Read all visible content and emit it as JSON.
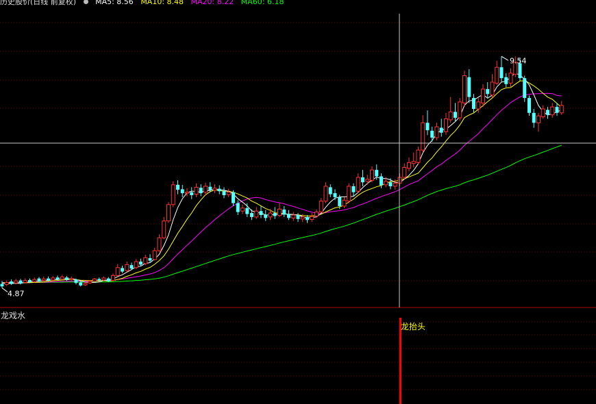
{
  "header": {
    "title": "历史股价(日线 前复权)",
    "ma_labels": [
      {
        "text": "MA5: 8.56",
        "color": "#ffffff"
      },
      {
        "text": "MA10: 8.48",
        "color": "#ffff00"
      },
      {
        "text": "MA20: 8.22",
        "color": "#ff00ff"
      },
      {
        "text": "MA60: 6.18",
        "color": "#00ff00"
      }
    ]
  },
  "indicator": {
    "name": "龙戏水",
    "signal_label": "龙抬头",
    "signal_color": "#ff0000"
  },
  "chart_data": {
    "type": "candlestick",
    "high_label": "9.54",
    "low_label": "4.87",
    "y_range": [
      4.6,
      10.4
    ],
    "candles": [
      [
        4.95,
        4.9,
        5.01,
        4.87
      ],
      [
        4.94,
        4.98,
        5.02,
        4.91
      ],
      [
        5.0,
        4.95,
        5.04,
        4.93
      ],
      [
        4.97,
        5.01,
        5.05,
        4.94
      ],
      [
        5.02,
        4.96,
        5.05,
        4.94
      ],
      [
        4.98,
        5.02,
        5.06,
        4.96
      ],
      [
        5.03,
        4.99,
        5.06,
        4.97
      ],
      [
        5.0,
        5.04,
        5.08,
        4.98
      ],
      [
        5.06,
        5.0,
        5.09,
        4.98
      ],
      [
        5.02,
        5.05,
        5.1,
        5.0
      ],
      [
        5.06,
        5.02,
        5.1,
        5.0
      ],
      [
        5.03,
        5.07,
        5.11,
        5.01
      ],
      [
        5.08,
        5.04,
        5.12,
        5.02
      ],
      [
        5.05,
        5.09,
        5.13,
        5.03
      ],
      [
        5.08,
        5.03,
        5.11,
        5.01
      ],
      [
        5.04,
        5.06,
        5.1,
        5.02
      ],
      [
        5.04,
        4.97,
        5.06,
        4.94
      ],
      [
        4.98,
        4.92,
        5.0,
        4.9
      ],
      [
        4.93,
        4.96,
        4.99,
        4.91
      ],
      [
        4.97,
        5.0,
        5.03,
        4.95
      ],
      [
        5.01,
        5.05,
        5.07,
        4.99
      ],
      [
        5.05,
        5.02,
        5.08,
        5.0
      ],
      [
        5.03,
        5.07,
        5.1,
        5.01
      ],
      [
        5.06,
        5.0,
        5.09,
        4.99
      ],
      [
        5.02,
        5.12,
        5.16,
        5.0
      ],
      [
        5.12,
        5.28,
        5.35,
        5.1
      ],
      [
        5.27,
        5.2,
        5.32,
        5.17
      ],
      [
        5.22,
        5.34,
        5.4,
        5.19
      ],
      [
        5.33,
        5.26,
        5.38,
        5.23
      ],
      [
        5.28,
        5.4,
        5.45,
        5.25
      ],
      [
        5.4,
        5.34,
        5.46,
        5.3
      ],
      [
        5.36,
        5.48,
        5.54,
        5.33
      ],
      [
        5.47,
        5.42,
        5.55,
        5.38
      ],
      [
        5.44,
        5.62,
        5.68,
        5.42
      ],
      [
        5.62,
        5.88,
        5.95,
        5.6
      ],
      [
        5.88,
        6.22,
        6.3,
        5.85
      ],
      [
        6.22,
        6.55,
        6.6,
        6.18
      ],
      [
        6.55,
        6.95,
        7.02,
        6.5
      ],
      [
        6.95,
        6.85,
        7.04,
        6.76
      ],
      [
        6.86,
        6.78,
        6.95,
        6.7
      ],
      [
        6.78,
        6.8,
        6.88,
        6.72
      ],
      [
        6.8,
        6.74,
        6.9,
        6.66
      ],
      [
        6.76,
        6.9,
        6.98,
        6.7
      ],
      [
        6.89,
        6.78,
        6.96,
        6.72
      ],
      [
        6.8,
        6.92,
        6.99,
        6.74
      ],
      [
        6.91,
        6.84,
        7.0,
        6.8
      ],
      [
        6.84,
        6.88,
        6.96,
        6.78
      ],
      [
        6.87,
        6.82,
        6.94,
        6.76
      ],
      [
        6.82,
        6.74,
        6.9,
        6.68
      ],
      [
        6.75,
        6.8,
        6.87,
        6.7
      ],
      [
        6.8,
        6.58,
        6.84,
        6.52
      ],
      [
        6.58,
        6.4,
        6.64,
        6.34
      ],
      [
        6.42,
        6.48,
        6.55,
        6.36
      ],
      [
        6.48,
        6.36,
        6.58,
        6.3
      ],
      [
        6.38,
        6.3,
        6.45,
        6.24
      ],
      [
        6.3,
        6.42,
        6.5,
        6.26
      ],
      [
        6.42,
        6.34,
        6.52,
        6.28
      ],
      [
        6.35,
        6.28,
        6.44,
        6.22
      ],
      [
        6.3,
        6.38,
        6.46,
        6.24
      ],
      [
        6.38,
        6.32,
        6.5,
        6.26
      ],
      [
        6.33,
        6.46,
        6.58,
        6.3
      ],
      [
        6.45,
        6.35,
        6.52,
        6.3
      ],
      [
        6.36,
        6.28,
        6.44,
        6.24
      ],
      [
        6.28,
        6.34,
        6.4,
        6.22
      ],
      [
        6.34,
        6.26,
        6.38,
        6.2
      ],
      [
        6.26,
        6.3,
        6.36,
        6.2
      ],
      [
        6.3,
        6.24,
        6.34,
        6.18
      ],
      [
        6.25,
        6.31,
        6.38,
        6.2
      ],
      [
        6.32,
        6.4,
        6.45,
        6.28
      ],
      [
        6.4,
        6.62,
        6.68,
        6.38
      ],
      [
        6.62,
        6.92,
        7.0,
        6.58
      ],
      [
        6.9,
        6.76,
        6.96,
        6.7
      ],
      [
        6.78,
        6.7,
        6.86,
        6.64
      ],
      [
        6.7,
        6.52,
        6.75,
        6.46
      ],
      [
        6.52,
        6.64,
        6.7,
        6.48
      ],
      [
        6.62,
        6.92,
        6.98,
        6.58
      ],
      [
        6.92,
        6.8,
        6.98,
        6.72
      ],
      [
        6.82,
        7.1,
        7.18,
        6.78
      ],
      [
        7.1,
        7.0,
        7.25,
        6.92
      ],
      [
        7.02,
        7.06,
        7.15,
        6.95
      ],
      [
        7.04,
        7.25,
        7.32,
        7.0
      ],
      [
        7.25,
        7.12,
        7.36,
        7.05
      ],
      [
        7.12,
        6.94,
        7.18,
        6.88
      ],
      [
        6.95,
        7.02,
        7.1,
        6.9
      ],
      [
        7.0,
        6.92,
        7.08,
        6.86
      ],
      [
        6.92,
        6.98,
        7.06,
        6.85
      ],
      [
        6.98,
        7.1,
        7.18,
        6.92
      ],
      [
        7.1,
        7.3,
        7.38,
        7.05
      ],
      [
        7.28,
        7.4,
        7.5,
        7.22
      ],
      [
        7.38,
        7.42,
        7.6,
        7.3
      ],
      [
        7.4,
        7.65,
        7.72,
        7.35
      ],
      [
        7.65,
        8.2,
        8.35,
        7.6
      ],
      [
        8.2,
        8.05,
        8.45,
        7.95
      ],
      [
        8.04,
        7.9,
        8.12,
        7.82
      ],
      [
        7.9,
        8.12,
        8.2,
        7.85
      ],
      [
        8.1,
        8.0,
        8.28,
        7.92
      ],
      [
        8.02,
        8.28,
        8.4,
        7.96
      ],
      [
        8.26,
        8.42,
        8.72,
        8.2
      ],
      [
        8.42,
        8.3,
        8.6,
        8.22
      ],
      [
        8.3,
        8.62,
        8.7,
        8.24
      ],
      [
        8.6,
        9.15,
        9.25,
        8.52
      ],
      [
        9.12,
        8.72,
        9.28,
        8.6
      ],
      [
        8.7,
        8.48,
        8.78,
        8.4
      ],
      [
        8.48,
        8.62,
        8.7,
        8.4
      ],
      [
        8.6,
        8.88,
        8.98,
        8.52
      ],
      [
        8.88,
        8.78,
        9.02,
        8.7
      ],
      [
        8.76,
        9.02,
        9.18,
        8.7
      ],
      [
        9.0,
        9.32,
        9.45,
        8.96
      ],
      [
        9.32,
        9.1,
        9.54,
        9.02
      ],
      [
        9.12,
        8.98,
        9.2,
        8.92
      ],
      [
        9.0,
        9.2,
        9.3,
        8.92
      ],
      [
        9.18,
        9.42,
        9.54,
        9.12
      ],
      [
        9.4,
        9.1,
        9.5,
        9.04
      ],
      [
        9.1,
        8.7,
        9.15,
        8.62
      ],
      [
        8.7,
        8.4,
        8.75,
        8.34
      ],
      [
        8.4,
        8.2,
        8.48,
        8.1
      ],
      [
        8.2,
        8.34,
        8.4,
        8.02
      ],
      [
        8.32,
        8.48,
        8.55,
        8.28
      ],
      [
        8.46,
        8.36,
        8.52,
        8.28
      ],
      [
        8.36,
        8.52,
        8.6,
        8.3
      ],
      [
        8.52,
        8.4,
        8.6,
        8.34
      ],
      [
        8.4,
        8.55,
        8.64,
        8.36
      ]
    ]
  }
}
